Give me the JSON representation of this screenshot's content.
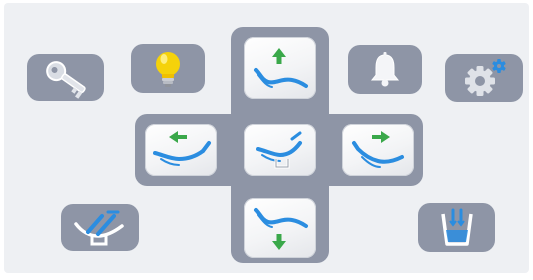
{
  "panel": {
    "buttons": [
      {
        "name": "key-button",
        "icon": "key-icon"
      },
      {
        "name": "light-button",
        "icon": "light-bulb-icon"
      },
      {
        "name": "chair-up-button",
        "icon": "chair-up-icon"
      },
      {
        "name": "bell-button",
        "icon": "bell-icon"
      },
      {
        "name": "settings-button",
        "icon": "gear-icon"
      },
      {
        "name": "backrest-forward-button",
        "icon": "chair-tilt-left-icon"
      },
      {
        "name": "chair-position-button",
        "icon": "chair-position-icon"
      },
      {
        "name": "backrest-back-button",
        "icon": "chair-tilt-right-icon"
      },
      {
        "name": "chair-down-button",
        "icon": "chair-down-icon"
      },
      {
        "name": "chair-memory-button",
        "icon": "chair-memory-icon"
      },
      {
        "name": "cup-fill-button",
        "icon": "cup-fill-icon"
      }
    ],
    "colors": {
      "frame": "#8e95a6",
      "tile": "#f3f4f6",
      "arrow_green": "#3aa84a",
      "chair_blue": "#2b8de0",
      "bulb_yellow": "#f5d20a"
    }
  }
}
